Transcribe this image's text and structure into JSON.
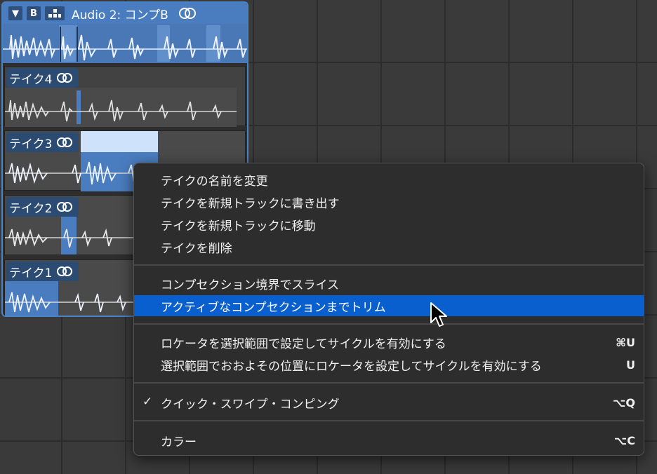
{
  "comp_track": {
    "collapse_glyph": "▼",
    "b_label": "B",
    "title": "Audio 2: コンプB",
    "icons": [
      "triangle-down-icon",
      "hierarchy-icon",
      "loop-rings-icon"
    ]
  },
  "takes": [
    {
      "label": "テイク4"
    },
    {
      "label": "テイク3"
    },
    {
      "label": "テイク2"
    },
    {
      "label": "テイク1"
    }
  ],
  "menu": {
    "items": [
      {
        "label": "テイクの名前を変更",
        "shortcut": ""
      },
      {
        "label": "テイクを新規トラックに書き出す",
        "shortcut": ""
      },
      {
        "label": "テイクを新規トラックに移動",
        "shortcut": ""
      },
      {
        "label": "テイクを削除",
        "shortcut": ""
      },
      {
        "label": "コンプセクション境界でスライス",
        "shortcut": ""
      },
      {
        "label": "アクティブなコンプセクションまでトリム",
        "shortcut": "",
        "highlighted": true
      },
      {
        "label": "ロケータを選択範囲で設定してサイクルを有効にする",
        "shortcut": "⌘U"
      },
      {
        "label": "選択範囲でおおよその位置にロケータを設定してサイクルを有効にする",
        "shortcut": "U"
      },
      {
        "label": "クイック・スワイプ・コンピング",
        "shortcut": "⌥Q",
        "checked": true,
        "check_glyph": "✓"
      },
      {
        "label": "カラー",
        "shortcut": "⌥C"
      }
    ]
  },
  "colors": {
    "background": "#3a3a3a",
    "comp_header": "#4a7dbf",
    "take_label_bg": "#2b4b73",
    "menu_bg": "#2d2d2d",
    "highlight": "#0a5fcf"
  }
}
